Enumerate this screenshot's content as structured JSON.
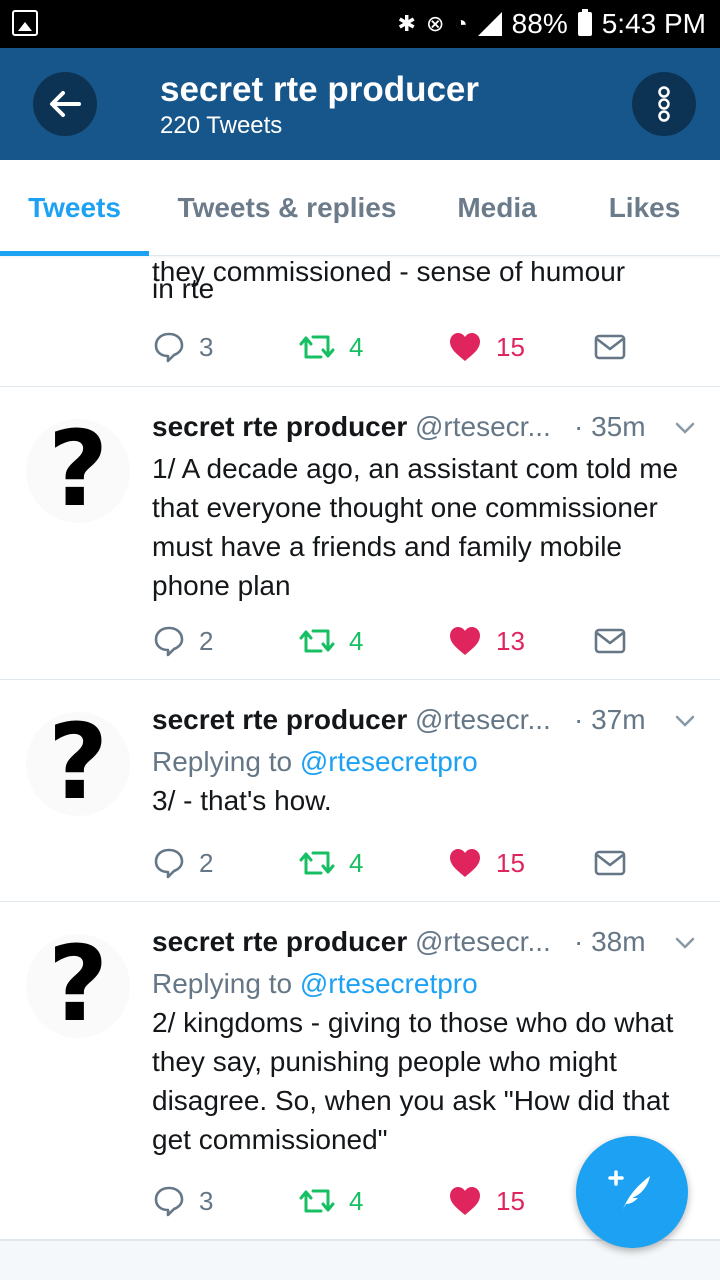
{
  "status_bar": {
    "battery": "88%",
    "time": "5:43 PM"
  },
  "header": {
    "title": "secret rte producer",
    "subtitle": "220 Tweets"
  },
  "tabs": [
    {
      "label": "Tweets",
      "active": true
    },
    {
      "label": "Tweets & replies",
      "active": false
    },
    {
      "label": "Media",
      "active": false
    },
    {
      "label": "Likes",
      "active": false
    }
  ],
  "tweets": [
    {
      "partial_text": "they commissioned - sense of humour",
      "body": "in rte",
      "replies": "3",
      "retweets": "4",
      "likes": "15"
    },
    {
      "name": "secret rte producer",
      "handle": "@rtesecr...",
      "time": "· 35m",
      "body": "1/ A decade ago, an assistant com told me that everyone thought one commissioner must have a friends and family mobile phone plan",
      "replies": "2",
      "retweets": "4",
      "likes": "13"
    },
    {
      "name": "secret rte producer",
      "handle": "@rtesecr...",
      "time": "· 37m",
      "reply_prefix": "Replying to ",
      "reply_to": "@rtesecretpro",
      "body": "3/ - that's how.",
      "replies": "2",
      "retweets": "4",
      "likes": "15"
    },
    {
      "name": "secret rte producer",
      "handle": "@rtesecr...",
      "time": "· 38m",
      "reply_prefix": "Replying to ",
      "reply_to": "@rtesecretpro",
      "body": "2/ kingdoms - giving to those who do what they say, punishing people who might disagree. So, when you ask \"How did that get commissioned\"",
      "replies": "3",
      "retweets": "4",
      "likes": "15"
    }
  ],
  "avatar_glyph": "?",
  "icons": {
    "back": "arrow-left-icon",
    "more": "more-vertical-icon",
    "reply": "reply-bubble-icon",
    "retweet": "retweet-icon",
    "like": "heart-icon",
    "dm": "envelope-icon",
    "compose": "compose-feather-icon"
  },
  "colors": {
    "header_bg": "#17568a",
    "accent": "#1da1f2",
    "retweet": "#17bf63",
    "like": "#e0245e",
    "muted": "#657786"
  }
}
